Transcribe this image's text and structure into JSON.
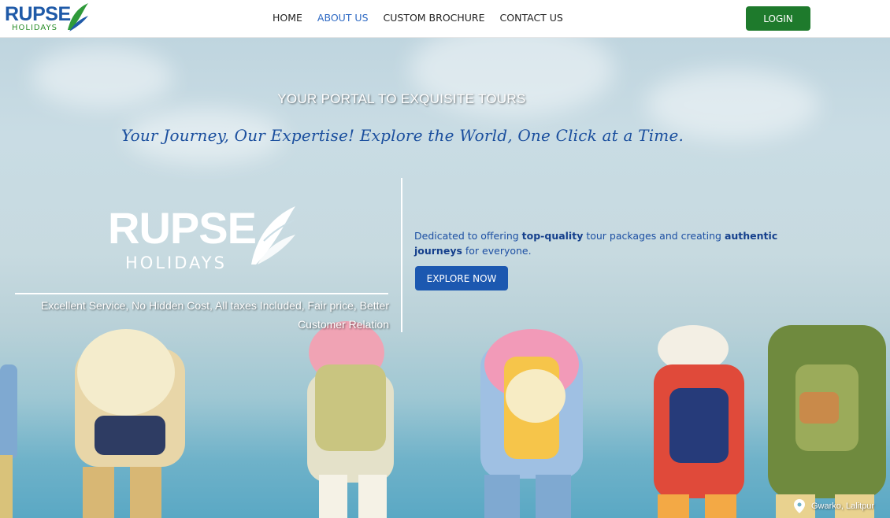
{
  "header": {
    "logo": {
      "word": "RUPSE",
      "sub": "HOLIDAYS"
    },
    "nav": [
      {
        "label": "HOME",
        "active": false
      },
      {
        "label": "ABOUT US",
        "active": true
      },
      {
        "label": "CUSTOM BROCHURE",
        "active": false
      },
      {
        "label": "CONTACT US",
        "active": false
      }
    ],
    "login_label": "LOGIN"
  },
  "hero": {
    "overline": "YOUR PORTAL TO EXQUISITE TOURS",
    "tagline": "Your Journey, Our Expertise! Explore the World, One Click at a Time.",
    "logo": {
      "word": "RUPSE",
      "sub": "HOLIDAYS"
    },
    "motto": "Excellent Service, No Hidden Cost, All taxes Included, Fair price, Better Customer Relation",
    "description": {
      "part1": "Dedicated to offering ",
      "bold1": "top-quality",
      "part2": " tour packages and creating ",
      "bold2": "authentic journeys",
      "part3": " for everyone."
    },
    "explore_label": "EXPLORE NOW",
    "location": "Gwarko, Lalitpur"
  },
  "colors": {
    "brand_blue": "#1f5aa8",
    "brand_green": "#1e7a2c",
    "nav_active": "#2f6ac4"
  }
}
